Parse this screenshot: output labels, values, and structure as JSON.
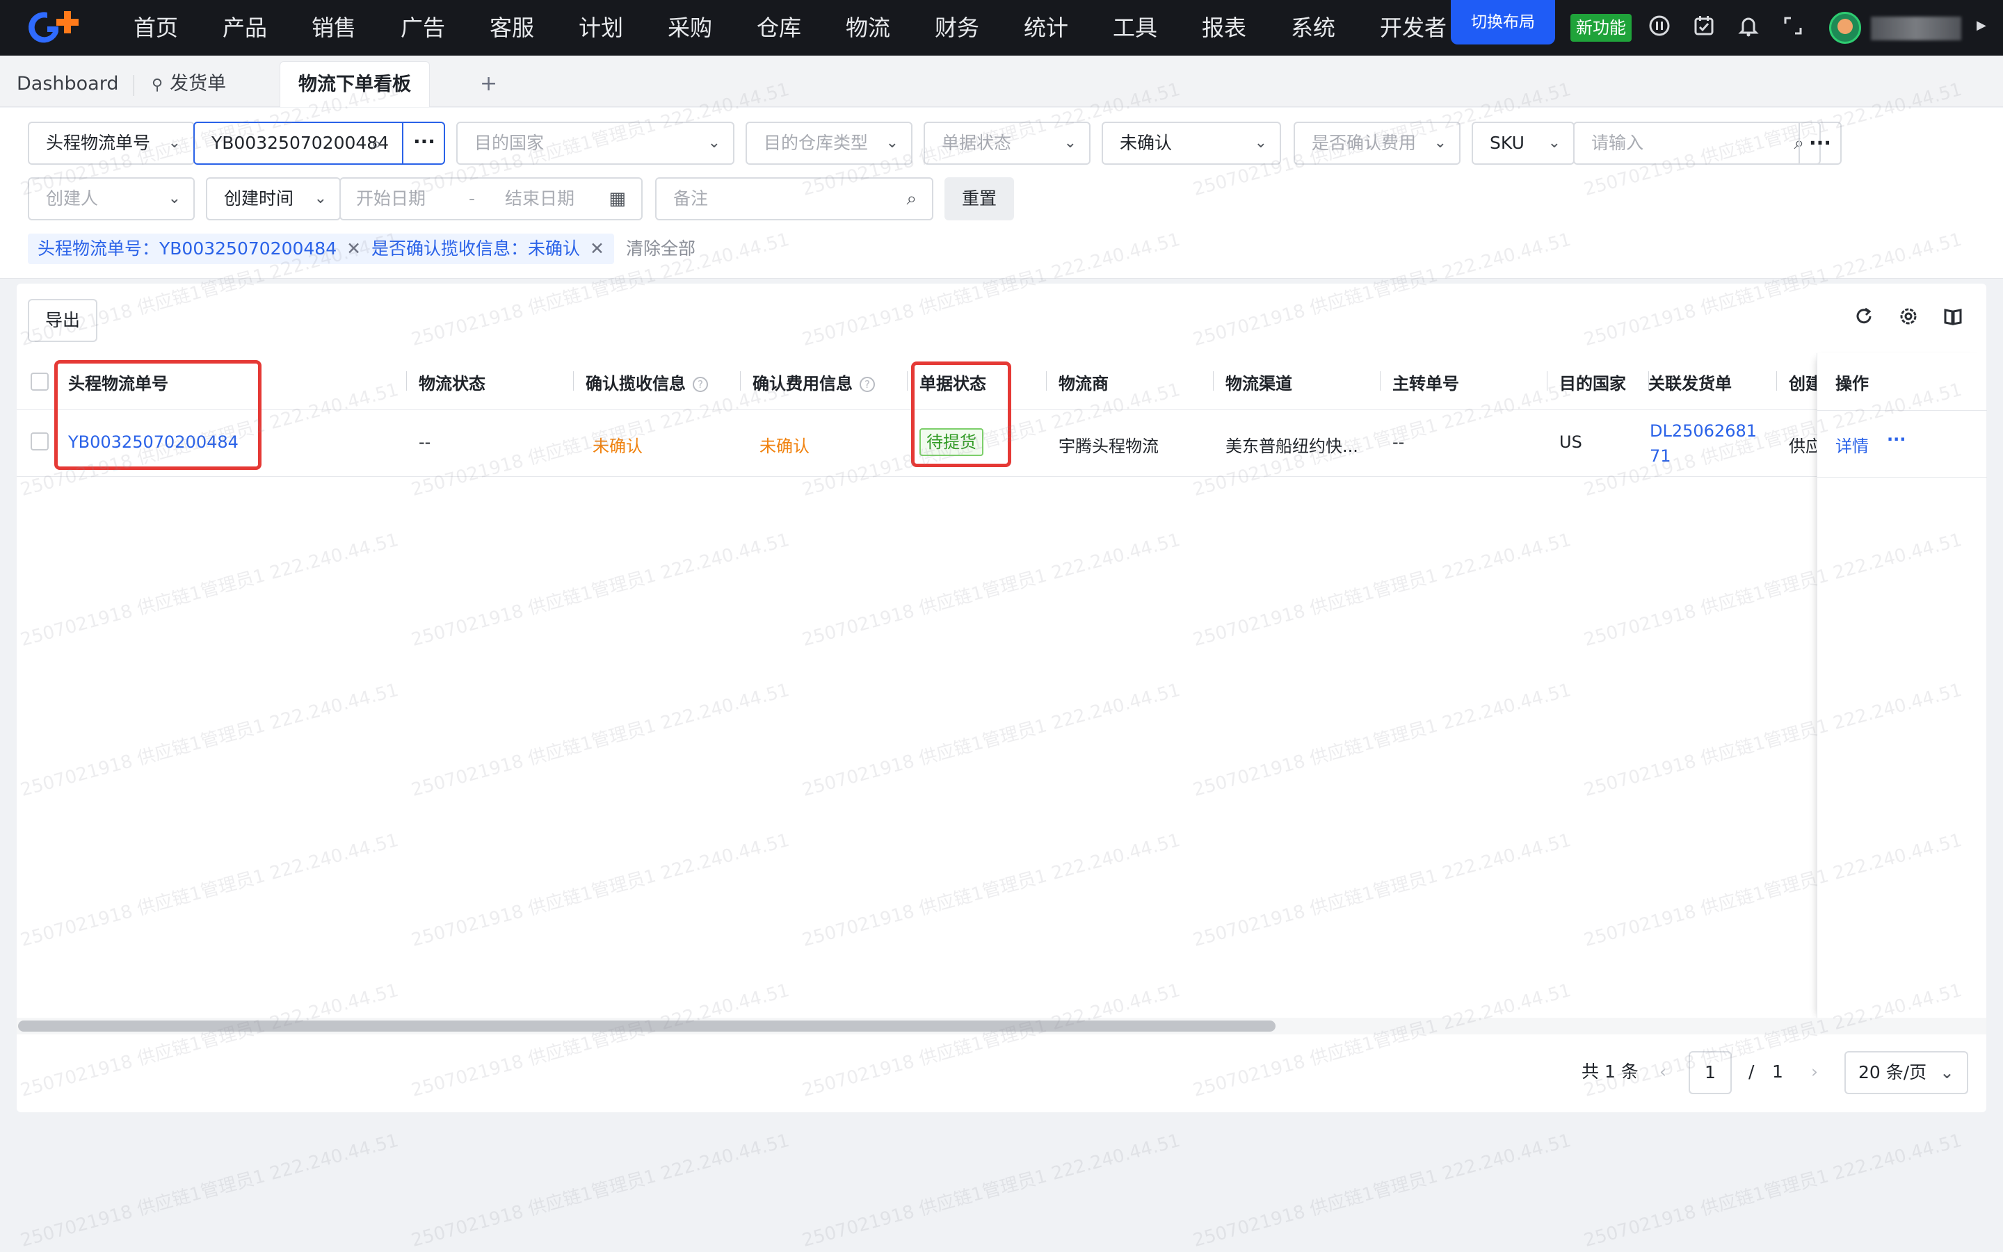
{
  "nav": {
    "items": [
      "首页",
      "产品",
      "销售",
      "广告",
      "客服",
      "计划",
      "采购",
      "仓库",
      "物流",
      "财务",
      "统计",
      "工具",
      "报表",
      "系统",
      "开发者"
    ],
    "switch_layout": "切换布局",
    "new_feature": "新功能"
  },
  "tabs": [
    "Dashboard",
    "发货单",
    "物流下单看板"
  ],
  "tab_add": "+",
  "filters": {
    "tracking_type": "头程物流单号",
    "tracking_value": "YB00325070200484",
    "dest_country": "目的国家",
    "warehouse_type": "目的仓库类型",
    "doc_status": "单据状态",
    "confirm_status": "未确认",
    "fee_confirm": "是否确认费用",
    "sku_type": "SKU",
    "sku_placeholder": "请输入",
    "creator": "创建人",
    "date_type": "创建时间",
    "start_date": "开始日期",
    "date_sep": "-",
    "end_date": "结束日期",
    "remark": "备注",
    "reset": "重置",
    "more": "···"
  },
  "active_tags": [
    {
      "label": "头程物流单号：YB00325070200484"
    },
    {
      "label": "是否确认揽收信息：未确认"
    }
  ],
  "clear_all": "清除全部",
  "toolbar": {
    "export": "导出"
  },
  "table": {
    "columns": [
      "头程物流单号",
      "物流状态",
      "确认揽收信息",
      "确认费用信息",
      "单据状态",
      "物流商",
      "物流渠道",
      "主转单号",
      "目的国家",
      "关联发货单",
      "创建",
      "操作"
    ],
    "help_mark": "?",
    "rows": [
      {
        "tracking_no": "YB00325070200484",
        "logistics_status": "--",
        "pickup_confirm": "未确认",
        "fee_confirm": "未确认",
        "doc_status": "待提货",
        "carrier": "宇腾头程物流",
        "channel": "美东普船纽约快...",
        "master_no": "--",
        "country": "US",
        "shipment_no_line1": "DL25062681",
        "shipment_no_line2": "71",
        "creator": "供应",
        "detail": "详情",
        "more": "···"
      }
    ]
  },
  "pagination": {
    "total": "共 1 条",
    "current": "1",
    "sep": "/",
    "pages": "1",
    "page_size": "20 条/页",
    "prev": "‹",
    "next": "›"
  },
  "watermark": "2507021918 供应链1管理员1 222.240.44.51",
  "colors": {
    "nav_bg": "#16181d",
    "primary": "#2a62e8",
    "highlight": "#e53935",
    "warning": "#f0820f",
    "success": "#2f9a23"
  }
}
